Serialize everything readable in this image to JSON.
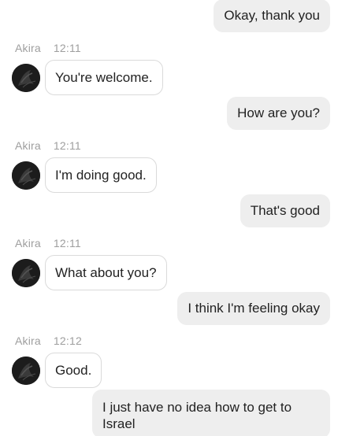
{
  "conversation": {
    "contact_name": "Akira",
    "messages": [
      {
        "from": "me",
        "text": "Okay, thank you"
      },
      {
        "from": "them",
        "author": "Akira",
        "time": "12:11",
        "text": "You're welcome."
      },
      {
        "from": "me",
        "text": "How are you?"
      },
      {
        "from": "them",
        "author": "Akira",
        "time": "12:11",
        "text": "I'm doing good."
      },
      {
        "from": "me",
        "text": "That's good"
      },
      {
        "from": "them",
        "author": "Akira",
        "time": "12:11",
        "text": "What about you?"
      },
      {
        "from": "me",
        "text": "I think I'm feeling okay"
      },
      {
        "from": "them",
        "author": "Akira",
        "time": "12:12",
        "text": "Good."
      },
      {
        "from": "me",
        "text": "I just have no idea how to get to Israel"
      }
    ]
  },
  "colors": {
    "outgoing_bubble": "#eeeeee",
    "incoming_bubble_border": "#dadada",
    "meta_text": "#9e9e9e",
    "text": "#222222"
  },
  "icons": {
    "avatar": "avatar-image"
  }
}
